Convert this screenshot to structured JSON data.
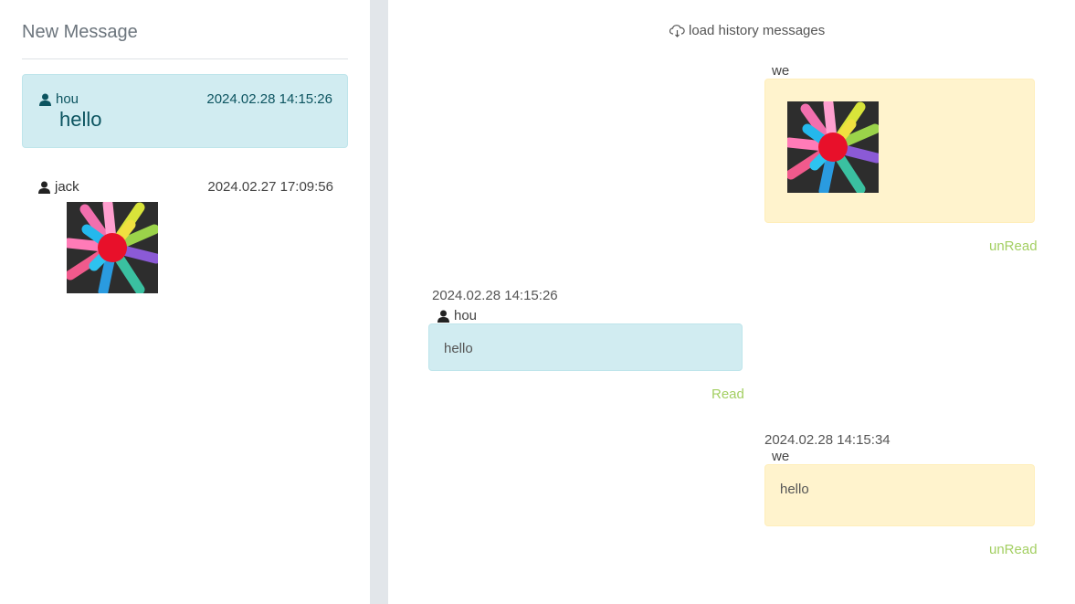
{
  "sidebar": {
    "title": "New Message",
    "conversations": [
      {
        "user": "hou",
        "time": "2024.02.28 14:15:26",
        "preview": "hello",
        "active": true
      },
      {
        "user": "jack",
        "time": "2024.02.27 17:09:56",
        "preview_type": "image",
        "active": false
      }
    ]
  },
  "chat": {
    "load_history": "load history messages",
    "messages": [
      {
        "sender": "we",
        "type": "image",
        "status": "unRead",
        "side": "right"
      },
      {
        "timestamp": "2024.02.28 14:15:26",
        "sender": "hou",
        "text": "hello",
        "status": "Read",
        "side": "left"
      },
      {
        "timestamp": "2024.02.28 14:15:34",
        "sender": "we",
        "text": "hello",
        "status": "unRead",
        "side": "right"
      }
    ]
  },
  "colors": {
    "active_bg": "#d1ecf1",
    "mine_bg": "#fff3cd",
    "status_green": "#a3cf62",
    "divider": "#e2e6ea"
  },
  "icons": {
    "user": "user-icon",
    "cloud": "cloud-download-icon",
    "image": "image-thumbnail"
  }
}
